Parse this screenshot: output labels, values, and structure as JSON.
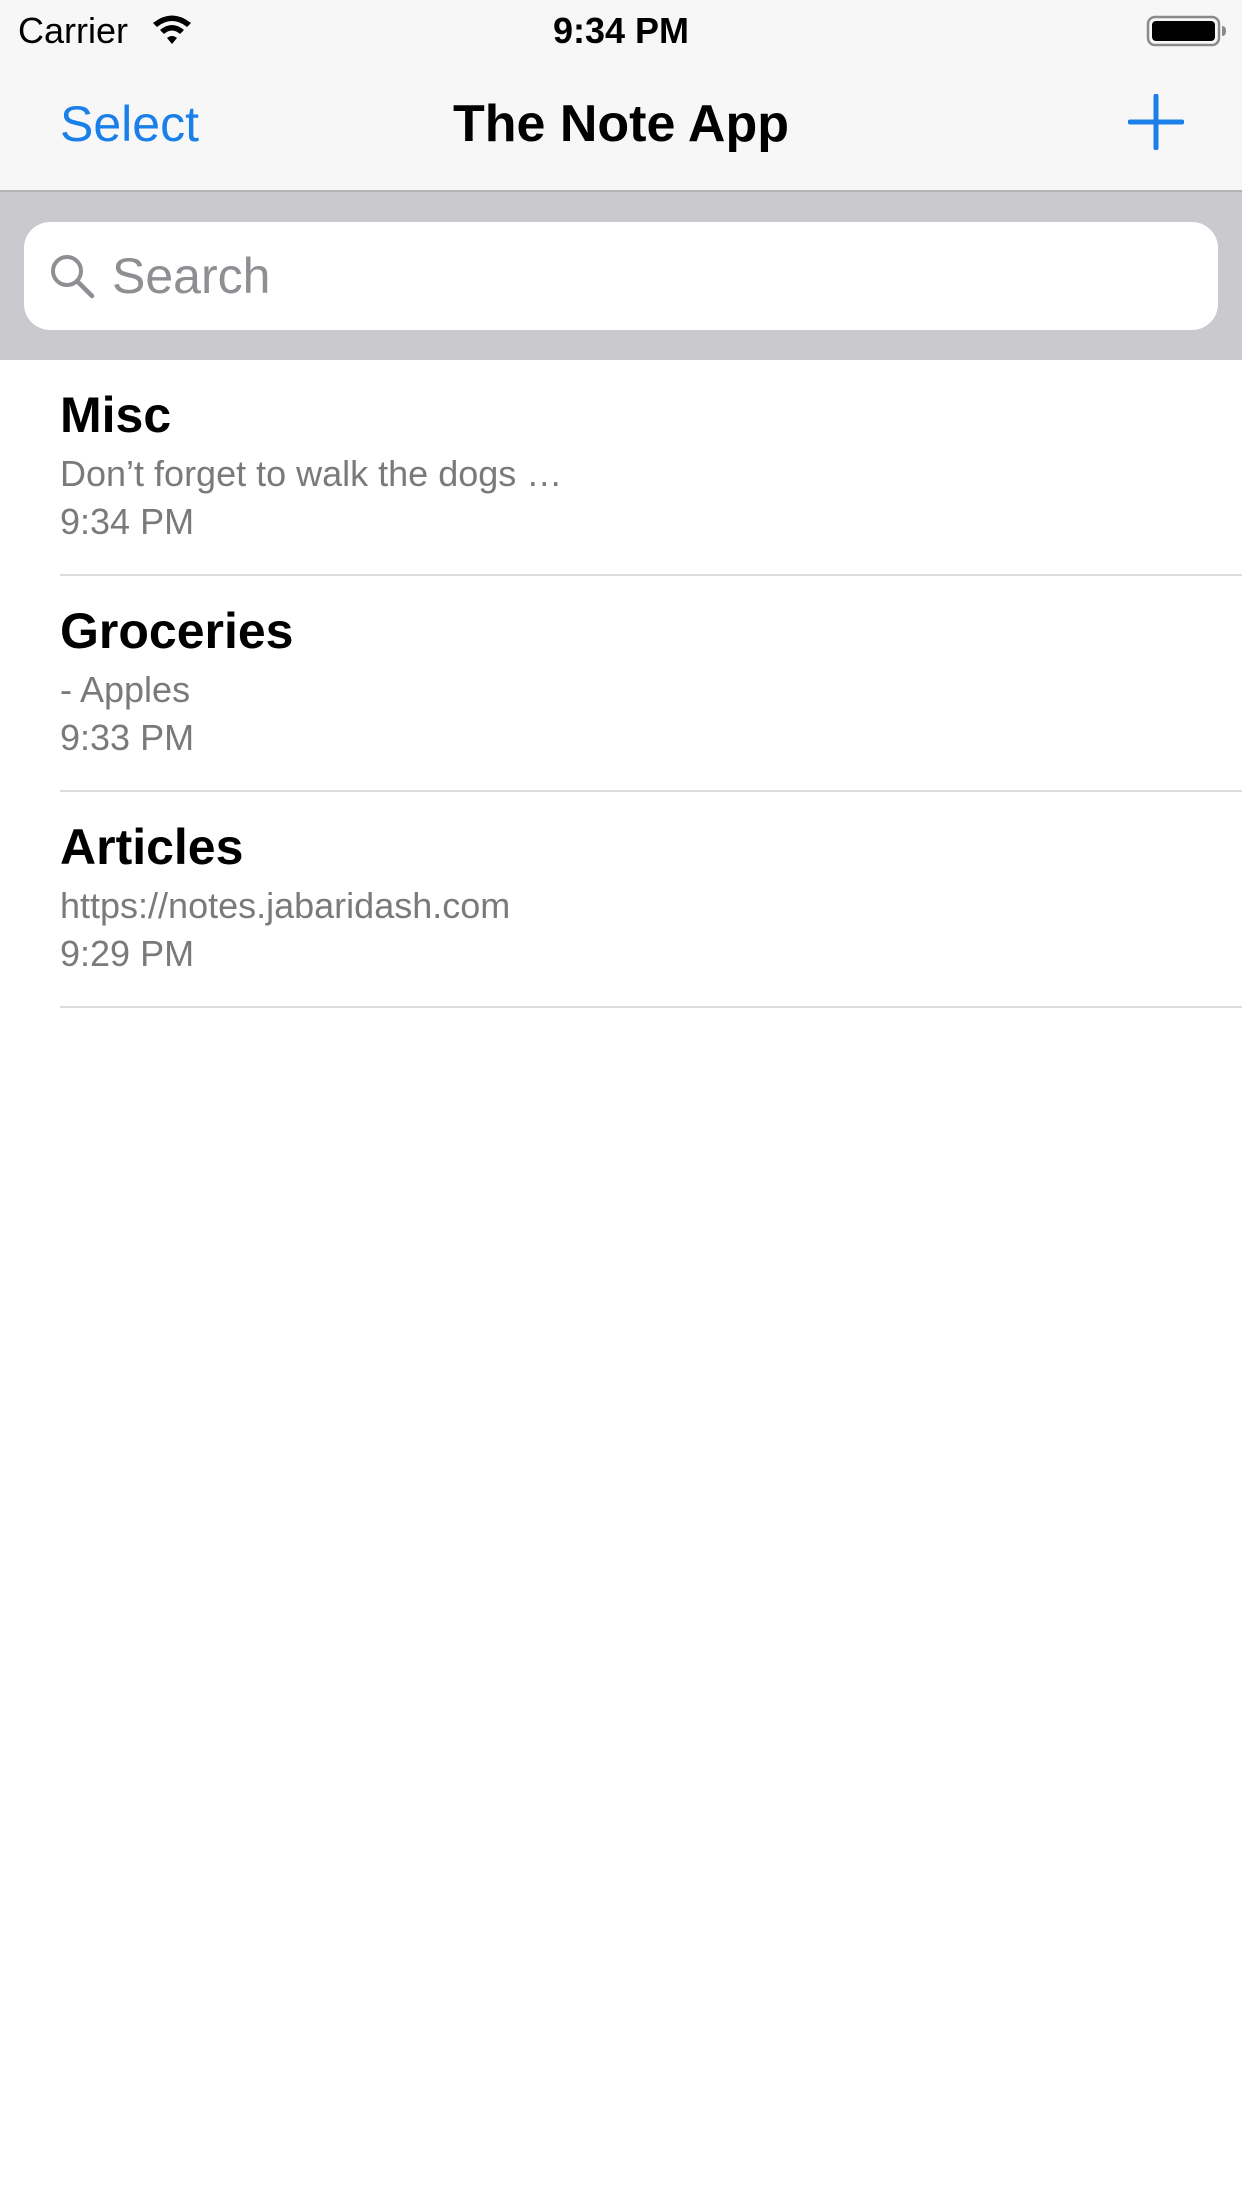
{
  "status_bar": {
    "carrier": "Carrier",
    "time": "9:34 PM",
    "wifi_icon": "wifi-icon",
    "battery_icon": "battery-icon"
  },
  "nav": {
    "left_button": "Select",
    "title": "The Note App",
    "right_icon": "plus-icon"
  },
  "search": {
    "placeholder": "Search",
    "value": "",
    "icon": "search-icon"
  },
  "notes": [
    {
      "title": "Misc",
      "preview": "Don’t forget to walk the dogs …",
      "time": "9:34 PM"
    },
    {
      "title": "Groceries",
      "preview": "- Apples",
      "time": "9:33 PM"
    },
    {
      "title": "Articles",
      "preview": "https://notes.jabaridash.com",
      "time": "9:29 PM"
    }
  ],
  "colors": {
    "accent": "#1a7fe8",
    "secondary_text": "#7a7a7a",
    "search_background": "#c9c9ce",
    "bar_background": "#f7f7f7"
  }
}
